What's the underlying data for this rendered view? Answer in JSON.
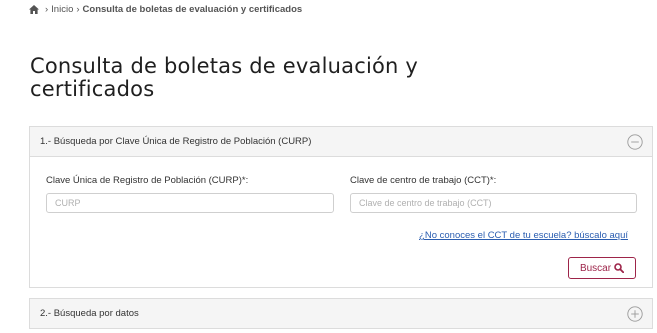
{
  "breadcrumb": {
    "home_icon": "home-icon",
    "separator": "›",
    "inicio": "Inicio",
    "current": "Consulta de boletas de evaluación y certificados"
  },
  "page": {
    "title": "Consulta de boletas de evaluación y certificados"
  },
  "panel_curp": {
    "heading": "1.- Búsqueda por Clave Única de Registro de Población (CURP)",
    "toggle_icon": "collapse-minus-icon",
    "curp_label": "Clave Única de Registro de Población (CURP)*:",
    "curp_placeholder": "CURP",
    "curp_value": "",
    "cct_label": "Clave de centro de trabajo (CCT)*:",
    "cct_placeholder": "Clave de centro de trabajo (CCT)",
    "cct_value": "",
    "help_link": "¿No conoces el CCT de tu escuela? búscalo aquí",
    "search_button": "Buscar",
    "search_icon": "search-icon"
  },
  "panel_datos": {
    "heading": "2.- Búsqueda por datos",
    "toggle_icon": "expand-plus-icon"
  },
  "colors": {
    "accent": "#9d2449",
    "link": "#2a5db0",
    "panel_header_bg": "#f5f5f5",
    "border": "#dcdcdc"
  }
}
